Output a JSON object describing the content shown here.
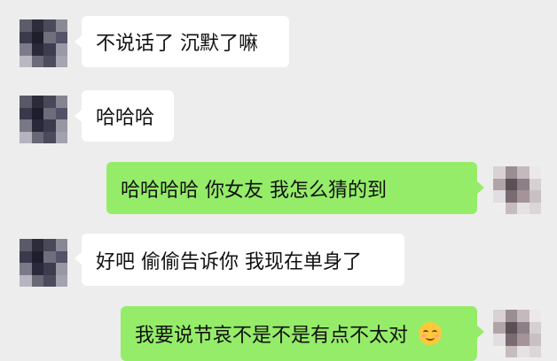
{
  "colors": {
    "background": "#ededed",
    "incoming_bubble": "#ffffff",
    "outgoing_bubble": "#95ec69"
  },
  "messages": [
    {
      "side": "left",
      "text": "不说话了 沉默了嘛"
    },
    {
      "side": "left",
      "text": "哈哈哈"
    },
    {
      "side": "right",
      "text": "哈哈哈哈   你女友   我怎么猜的到"
    },
    {
      "side": "left",
      "text": "好吧 偷偷告诉你 我现在单身了"
    },
    {
      "side": "right",
      "text": "我要说节哀不是不是有点不太对",
      "emoji": "smiling-face-emoji"
    }
  ]
}
